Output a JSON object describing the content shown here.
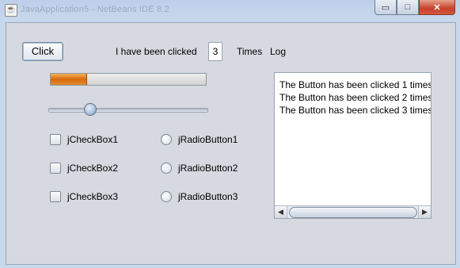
{
  "window": {
    "title": "JavaApplication5 - NetBeans IDE 8.2",
    "controls": {
      "minimize": "▭",
      "maximize": "□",
      "close": "✕"
    }
  },
  "form": {
    "click_button": "Click",
    "clicked_label": "I have been clicked",
    "count": "3",
    "times_label": "Times",
    "log_label": "Log",
    "progress_value_percent": 23,
    "slider_value_percent": 26,
    "checkboxes": [
      {
        "label": "jCheckBox1",
        "checked": false
      },
      {
        "label": "jCheckBox2",
        "checked": false
      },
      {
        "label": "jCheckBox3",
        "checked": false
      }
    ],
    "radios": [
      {
        "label": "jRadioButton1",
        "selected": false
      },
      {
        "label": "jRadioButton2",
        "selected": false
      },
      {
        "label": "jRadioButton3",
        "selected": false
      }
    ],
    "log_lines": [
      "The Button has been clicked 1 times",
      "The Button has been clicked 2 times",
      "The Button has been clicked 3 times"
    ],
    "scroll": {
      "left_arrow": "◀",
      "right_arrow": "▶"
    }
  }
}
